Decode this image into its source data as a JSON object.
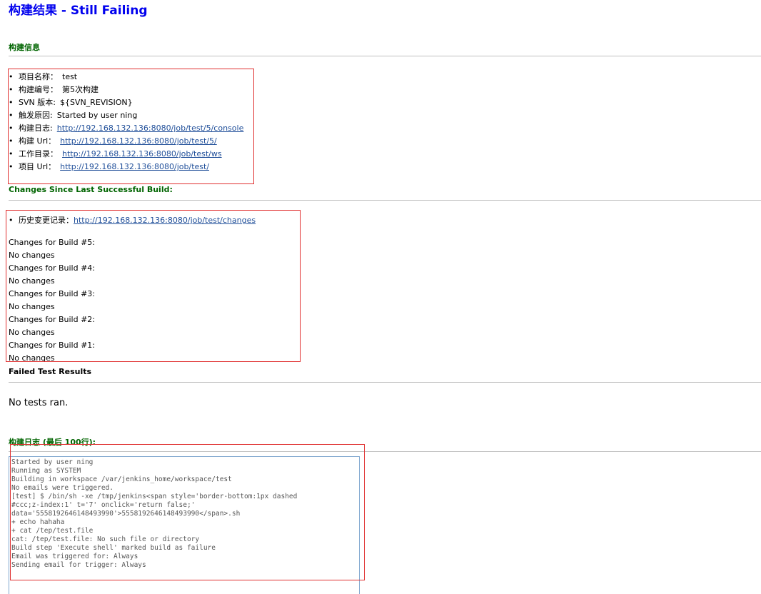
{
  "title": "构建结果 - Still Failing",
  "build_info": {
    "heading": "构建信息",
    "items": [
      {
        "label": "项目名称：",
        "value": "test"
      },
      {
        "label": "构建编号：",
        "value": "第5次构建"
      },
      {
        "label": "SVN 版本:",
        "value": "${SVN_REVISION}"
      },
      {
        "label": "触发原因:",
        "value": "Started by user ning"
      },
      {
        "label": "构建日志:",
        "link": "http://192.168.132.136:8080/job/test/5/console"
      },
      {
        "label": "构建  Url：",
        "link": "http://192.168.132.136:8080/job/test/5/"
      },
      {
        "label": "工作目录：",
        "link": "http://192.168.132.136:8080/job/test/ws"
      },
      {
        "label": "项目  Url：",
        "link": "http://192.168.132.136:8080/job/test/"
      }
    ]
  },
  "changes": {
    "heading": "Changes Since Last Successful Build:",
    "history_label": "历史变更记录：",
    "history_link": "http://192.168.132.136:8080/job/test/changes",
    "lines": [
      "Changes for Build #5:",
      "No changes",
      "Changes for Build #4:",
      "No changes",
      "Changes for Build #3:",
      "No changes",
      "Changes for Build #2:",
      "No changes",
      "Changes for Build #1:",
      "No changes"
    ]
  },
  "tests": {
    "heading": "Failed Test Results",
    "message": "No tests ran."
  },
  "log": {
    "heading": "构建日志 (最后 100行):",
    "text": "Started by user ning\nRunning as SYSTEM\nBuilding in workspace /var/jenkins_home/workspace/test\nNo emails were triggered.\n[test] $ /bin/sh -xe /tmp/jenkins<span style='border-bottom:1px dashed\n#ccc;z-index:1' t='7' onclick='return false;'\ndata='5558192646148493990'>5558192646148493990</span>.sh\n+ echo hahaha\n+ cat /tep/test.file\ncat: /tep/test.file: No such file or directory\nBuild step 'Execute shell' marked build as failure\nEmail was triggered for: Always\nSending email for trigger: Always"
  },
  "colors": {
    "title": "#0000ee",
    "heading": "#006400",
    "link": "#1f4e99",
    "highlight_box": "#e03030",
    "log_border": "#7fa7cf"
  }
}
